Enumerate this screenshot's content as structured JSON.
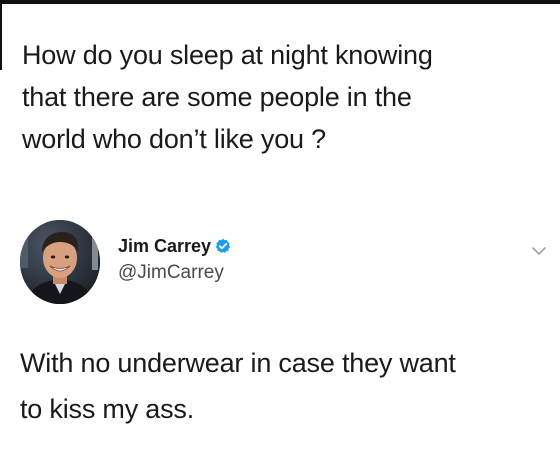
{
  "question": {
    "line1": "How do you sleep at night knowing",
    "line2": "that there are some people in the",
    "line3": "world who don’t like you ?"
  },
  "tweet": {
    "author_name": "Jim Carrey",
    "author_handle": "@JimCarrey",
    "verified": true,
    "avatar_icon": "profile-photo",
    "menu_icon": "chevron-down-icon",
    "text_line1": "With no underwear in case they want",
    "text_line2": "to kiss my ass."
  },
  "colors": {
    "verified_blue": "#1d9bf0",
    "text": "#1a1a1a",
    "handle": "#4a4a4a",
    "caret": "#9aa5b0"
  }
}
